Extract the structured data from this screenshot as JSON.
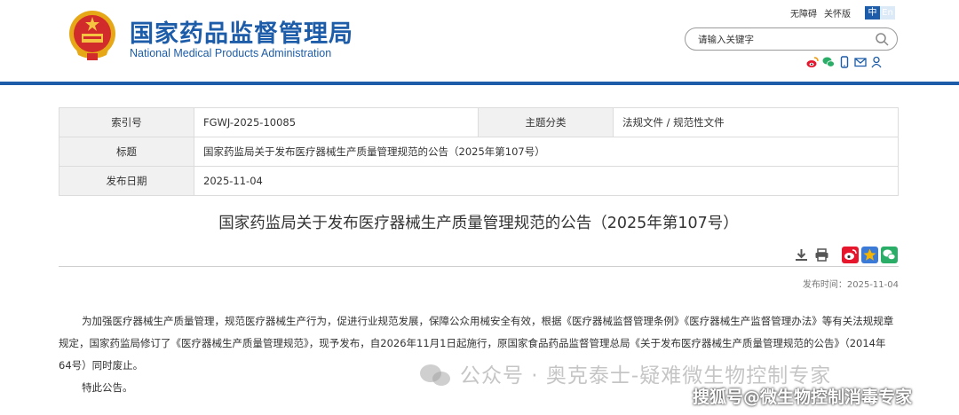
{
  "header": {
    "title_cn": "国家药品监督管理局",
    "title_en": "National Medical Products Administration",
    "links": [
      "无障碍",
      "关怀版"
    ],
    "lang": [
      "中",
      "En"
    ],
    "search": {
      "placeholder": "请输入关键字"
    },
    "social_icons": [
      "weibo-icon",
      "wechat-icon",
      "mobile-icon",
      "email-icon",
      "user-icon"
    ]
  },
  "meta": {
    "index_label": "索引号",
    "index_value": "FGWJ-2025-10085",
    "topic_label": "主题分类",
    "topic_value": "法规文件 / 规范性文件",
    "title_label": "标题",
    "title_value": "国家药监局关于发布医疗器械生产质量管理规范的公告（2025年第107号）",
    "date_label": "发布日期",
    "date_value": "2025-11-04"
  },
  "article": {
    "title": "国家药监局关于发布医疗器械生产质量管理规范的公告（2025年第107号）",
    "publish_time": "发布时间：2025-11-04",
    "paragraph_1": "为加强医疗器械生产质量管理，规范医疗器械生产行为，促进行业规范发展，保障公众用械安全有效，根据《医疗器械监督管理条例》《医疗器械生产监督管理办法》等有关法规规章规定，国家药监局修订了《医疗器械生产质量管理规范》，现予发布，自2026年11月1日起施行，原国家食品药品监督管理总局《关于发布医疗器械生产质量管理规范的公告》（2014年64号）同时废止。",
    "paragraph_2": "特此公告。"
  },
  "watermarks": {
    "wechat": "公众号 · 奥克泰士-疑难微生物控制专家",
    "sohu": "搜狐号@微生物控制消毒专家"
  },
  "colors": {
    "brand_blue": "#1d5ca8",
    "weibo_red": "#e6162d",
    "star_yellow": "#f5b400",
    "wechat_green": "#2aae67"
  }
}
